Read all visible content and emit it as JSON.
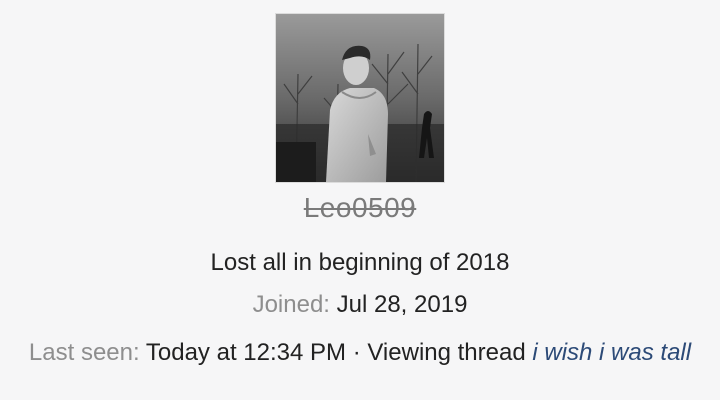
{
  "profile": {
    "avatar_icon": "user-profile-photo",
    "username": "Leo0509",
    "user_title": "Lost all in beginning of 2018",
    "joined_label": "Joined:",
    "joined_value": "Jul 28, 2019",
    "last_seen_label": "Last seen:",
    "last_seen_value": "Today at 12:34 PM",
    "separator": "·",
    "activity": "Viewing thread",
    "thread_title": "i wish i was tall"
  },
  "colors": {
    "background": "#f6f6f7",
    "muted_text": "#8e8e8e",
    "link": "#2c4a77"
  }
}
